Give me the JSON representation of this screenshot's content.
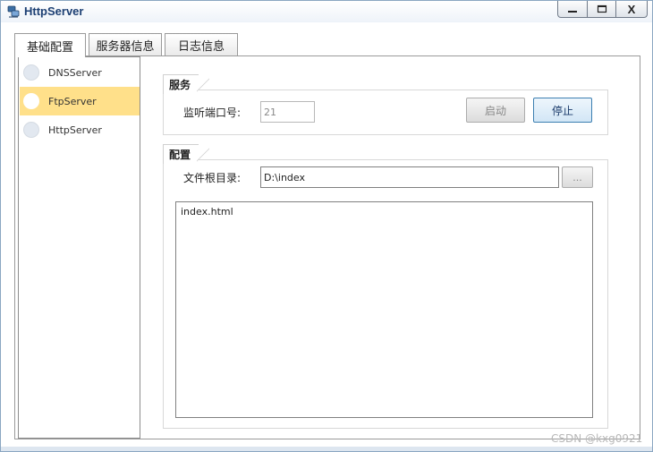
{
  "window": {
    "title": "HttpServer",
    "minimize_label": "",
    "maximize_label": "",
    "close_label": "X"
  },
  "tabs": [
    {
      "label": "基础配置",
      "selected": true
    },
    {
      "label": "服务器信息",
      "selected": false
    },
    {
      "label": "日志信息",
      "selected": false
    }
  ],
  "server_list": [
    {
      "label": "DNSServer",
      "selected": false
    },
    {
      "label": "FtpServer",
      "selected": true
    },
    {
      "label": "HttpServer",
      "selected": false
    }
  ],
  "service": {
    "header": "服务",
    "port_label": "监听端口号:",
    "port_value": "21",
    "start_label": "启动",
    "stop_label": "停止"
  },
  "config": {
    "header": "配置",
    "root_label": "文件根目录:",
    "root_value": "D:\\index",
    "browse_label": "...",
    "files": [
      "index.html"
    ]
  },
  "watermark": "CSDN @kxg0921",
  "colors": {
    "selected_item": "#ffe08a",
    "stop_button_border": "#3c7fb1",
    "title_text": "#1c3f73"
  }
}
